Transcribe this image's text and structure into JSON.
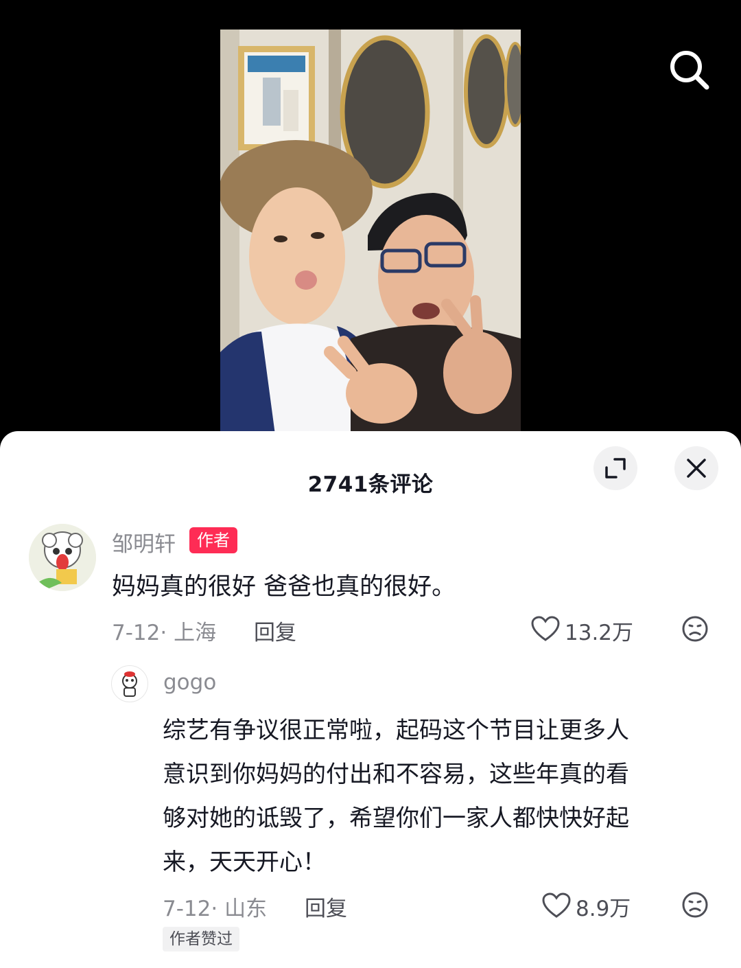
{
  "header": {
    "search_icon": "search-icon"
  },
  "comments_sheet": {
    "title": "2741条评论",
    "expand_icon": "expand-icon",
    "close_icon": "close-icon"
  },
  "comments": [
    {
      "username": "邹明轩",
      "badge": "作者",
      "text": "妈妈真的很好 爸爸也真的很好。",
      "meta": "7-12· 上海",
      "reply_label": "回复",
      "likes": "13.2万"
    }
  ],
  "replies": [
    {
      "username": "gogo",
      "text_lines": [
        "综艺有争议很正常啦，起码这个节目让更多人",
        "意识到你妈妈的付出和不容易，这些年真的看",
        "够对她的诋毁了，希望你们一家人都快快好起",
        "来，天天开心！"
      ],
      "meta": "7-12· 山东",
      "reply_label": "回复",
      "likes": "8.9万",
      "liked_by_author": "作者赞过"
    }
  ],
  "colors": {
    "accent": "#fe2c55",
    "text_primary": "#161823",
    "text_secondary": "#8a8b91"
  }
}
